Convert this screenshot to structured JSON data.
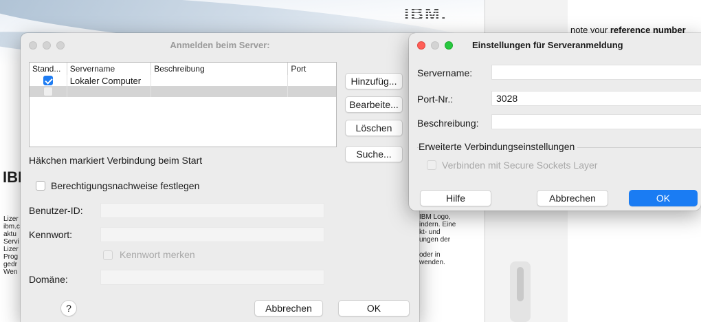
{
  "background": {
    "ibm_logo": "IBM.",
    "ibm_side": "IBM",
    "license_lines": [
      "Lizer",
      "ibm.c",
      "aktu",
      "Servi",
      "Lizer",
      "Prog",
      "gedr",
      "Wen"
    ],
    "right_lines": [
      "IBM Logo,",
      "indern. Eine",
      "kt- und",
      "ungen der",
      "",
      "oder in",
      "wenden."
    ],
    "note_prefix": "note your ",
    "note_bold": "reference number"
  },
  "login_dialog": {
    "title": "Anmelden beim Server:",
    "table": {
      "columns": [
        "Stand...",
        "Servername",
        "Beschreibung",
        "Port"
      ],
      "rows": [
        {
          "checked": true,
          "servername": "Lokaler Computer",
          "beschreibung": "",
          "port": ""
        },
        {
          "checked": false,
          "servername": "",
          "beschreibung": "",
          "port": ""
        }
      ]
    },
    "buttons": {
      "add": "Hinzufüg...",
      "edit": "Bearbeite...",
      "delete": "Löschen",
      "search": "Suche..."
    },
    "hint": "Häkchen markiert Verbindung beim Start",
    "credentials_label": "Berechtigungsnachweise festlegen",
    "user_id_label": "Benutzer-ID:",
    "user_id_value": "",
    "password_label": "Kennwort:",
    "password_value": "",
    "remember_label": "Kennwort merken",
    "domain_label": "Domäne:",
    "domain_value": "",
    "help": "?",
    "cancel": "Abbrechen",
    "ok": "OK"
  },
  "settings_dialog": {
    "title": "Einstellungen für Serveranmeldung",
    "servername_label": "Servername:",
    "servername_value": "",
    "port_label": "Port-Nr.:",
    "port_value": "3028",
    "description_label": "Beschreibung:",
    "description_value": "",
    "advanced_title": "Erweiterte Verbindungseinstellungen",
    "ssl_label": "Verbinden mit Secure Sockets Layer",
    "help": "Hilfe",
    "cancel": "Abbrechen",
    "ok": "OK"
  }
}
